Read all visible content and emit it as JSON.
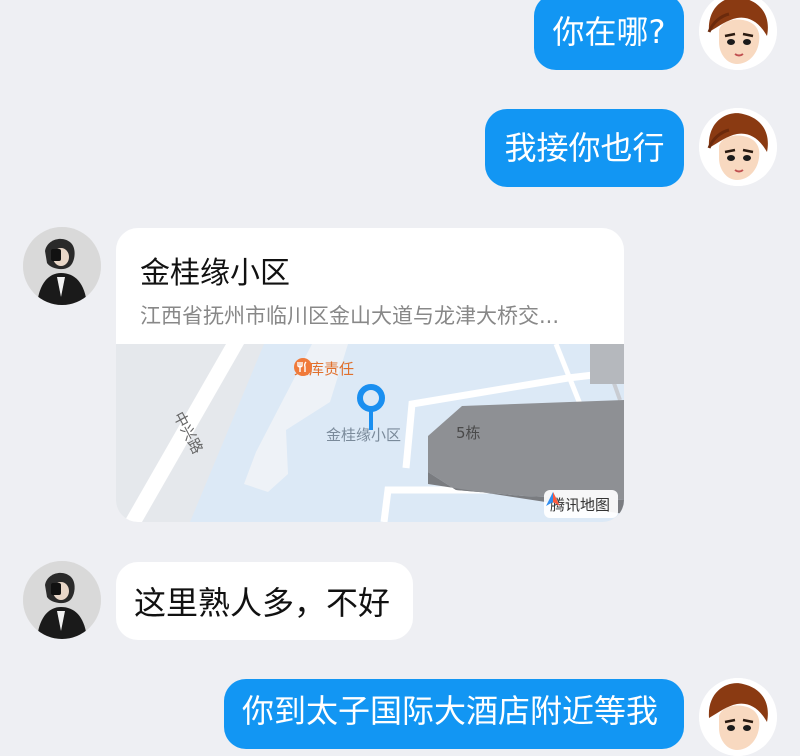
{
  "messages": {
    "m1": {
      "text": "你在哪?"
    },
    "m2": {
      "text": "我接你也行"
    },
    "location": {
      "title": "金桂缘小区",
      "address": "江西省抚州市临川区金山大道与龙津大桥交...",
      "map": {
        "road_label": "中兴路",
        "poi_label": "梁库责任",
        "pin_label": "金桂缘小区",
        "building_label": "5栋",
        "watermark": "腾讯地图"
      }
    },
    "m4": {
      "text": "这里熟人多，不好"
    },
    "m5": {
      "text": "你到太子国际大酒店附近等我"
    }
  },
  "colors": {
    "page_bg": "#eeeff3",
    "outgoing_bubble": "#1296f3",
    "incoming_bubble": "#ffffff",
    "pin": "#1a8ff0",
    "poi": "#f07a3a"
  },
  "icons": [
    "user-avatar-icon",
    "contact-avatar-icon",
    "map-pin-icon",
    "restaurant-poi-icon",
    "tencent-map-logo-icon"
  ]
}
